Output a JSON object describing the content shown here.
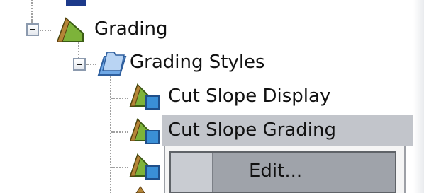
{
  "tree": {
    "nodes": [
      {
        "id": "grading",
        "label": "Grading",
        "expanded": true,
        "icon": "grading-terrain-icon"
      },
      {
        "id": "grading-styles",
        "label": "Grading Styles",
        "expanded": true,
        "icon": "folder-icon"
      },
      {
        "id": "cut-slope-display",
        "label": "Cut Slope Display",
        "icon": "grading-style-icon"
      },
      {
        "id": "cut-slope-grading",
        "label": "Cut Slope Grading",
        "icon": "grading-style-icon",
        "selected": true
      }
    ]
  },
  "context_menu": {
    "items": [
      {
        "label": "Edit...",
        "highlighted": true
      }
    ]
  },
  "colors": {
    "selection": "#c2c5cb",
    "menu_highlight": "#9fa3aa",
    "terrain_green": "#7db33a",
    "terrain_brown": "#8a5a1f",
    "style_blue": "#3a8fd6",
    "folder_blue": "#6fa8e6"
  }
}
